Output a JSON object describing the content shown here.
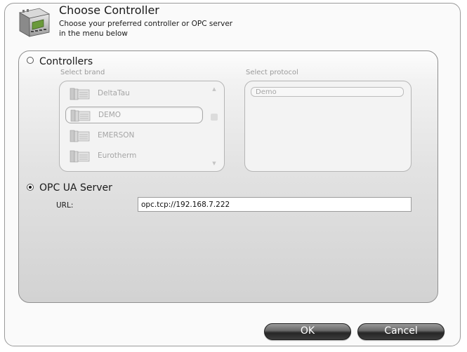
{
  "dialog": {
    "title": "Choose Controller",
    "subtitle": "Choose your preferred controller or OPC server in the menu below",
    "header_icon": "plc-controller-icon"
  },
  "controllers": {
    "radio_label": "Controllers",
    "selected": false,
    "brand_caption": "Select brand",
    "protocol_caption": "Select protocol",
    "brands": [
      {
        "label": "DeltaTau",
        "icon": "controller-module-icon",
        "selected": false
      },
      {
        "label": "DEMO",
        "icon": "controller-module-icon",
        "selected": true
      },
      {
        "label": "EMERSON",
        "icon": "controller-module-icon",
        "selected": false
      },
      {
        "label": "Eurotherm",
        "icon": "controller-module-icon",
        "selected": false
      }
    ],
    "protocols": [
      {
        "label": "Demo"
      }
    ]
  },
  "opc": {
    "radio_label": "OPC UA Server",
    "selected": true,
    "url_label": "URL:",
    "url_value": "opc.tcp://192.168.7.222"
  },
  "buttons": {
    "ok": "OK",
    "cancel": "Cancel"
  }
}
